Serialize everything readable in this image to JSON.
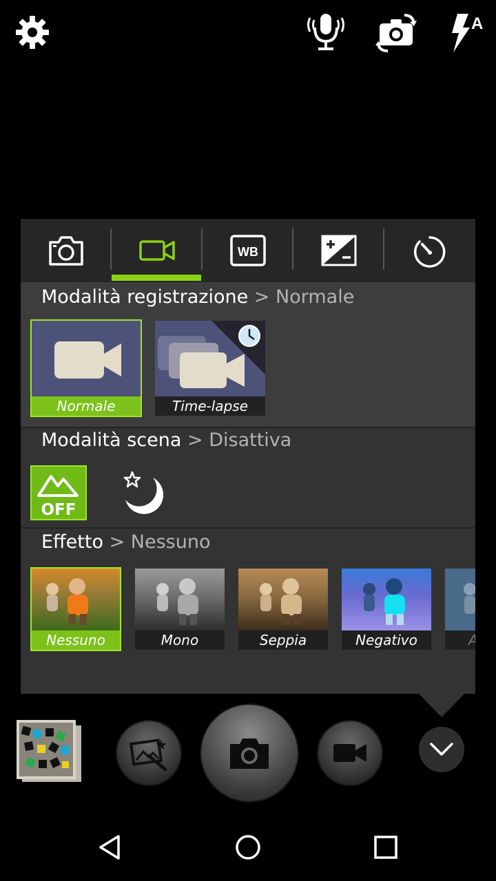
{
  "tabs": [
    {
      "name": "photo-tab",
      "icon": "camera-icon"
    },
    {
      "name": "video-tab",
      "icon": "video-camera-icon",
      "active": true
    },
    {
      "name": "white-balance-tab",
      "icon": "wb-icon",
      "label": "WB"
    },
    {
      "name": "exposure-tab",
      "icon": "exposure-icon"
    },
    {
      "name": "timer-tab",
      "icon": "timer-icon"
    }
  ],
  "recording": {
    "title": "Modalità registrazione",
    "separator": ">",
    "value": "Normale",
    "options": [
      {
        "label": "Normale",
        "selected": true
      },
      {
        "label": "Time-lapse",
        "selected": false
      }
    ]
  },
  "scene": {
    "title": "Modalità scena",
    "separator": ">",
    "value": "Disattiva",
    "off_label": "OFF",
    "options": [
      {
        "icon": "scene-off-icon",
        "selected": true
      },
      {
        "icon": "night-mode-icon",
        "selected": false
      }
    ]
  },
  "effect": {
    "title": "Effetto",
    "separator": ">",
    "value": "Nessuno",
    "options": [
      {
        "label": "Nessuno",
        "selected": true
      },
      {
        "label": "Mono",
        "selected": false
      },
      {
        "label": "Seppia",
        "selected": false
      },
      {
        "label": "Negativo",
        "selected": false
      },
      {
        "label": "A",
        "selected": false
      }
    ]
  },
  "colors": {
    "accent": "#8ad312",
    "panel": "#333333",
    "tabbar": "#262626"
  }
}
